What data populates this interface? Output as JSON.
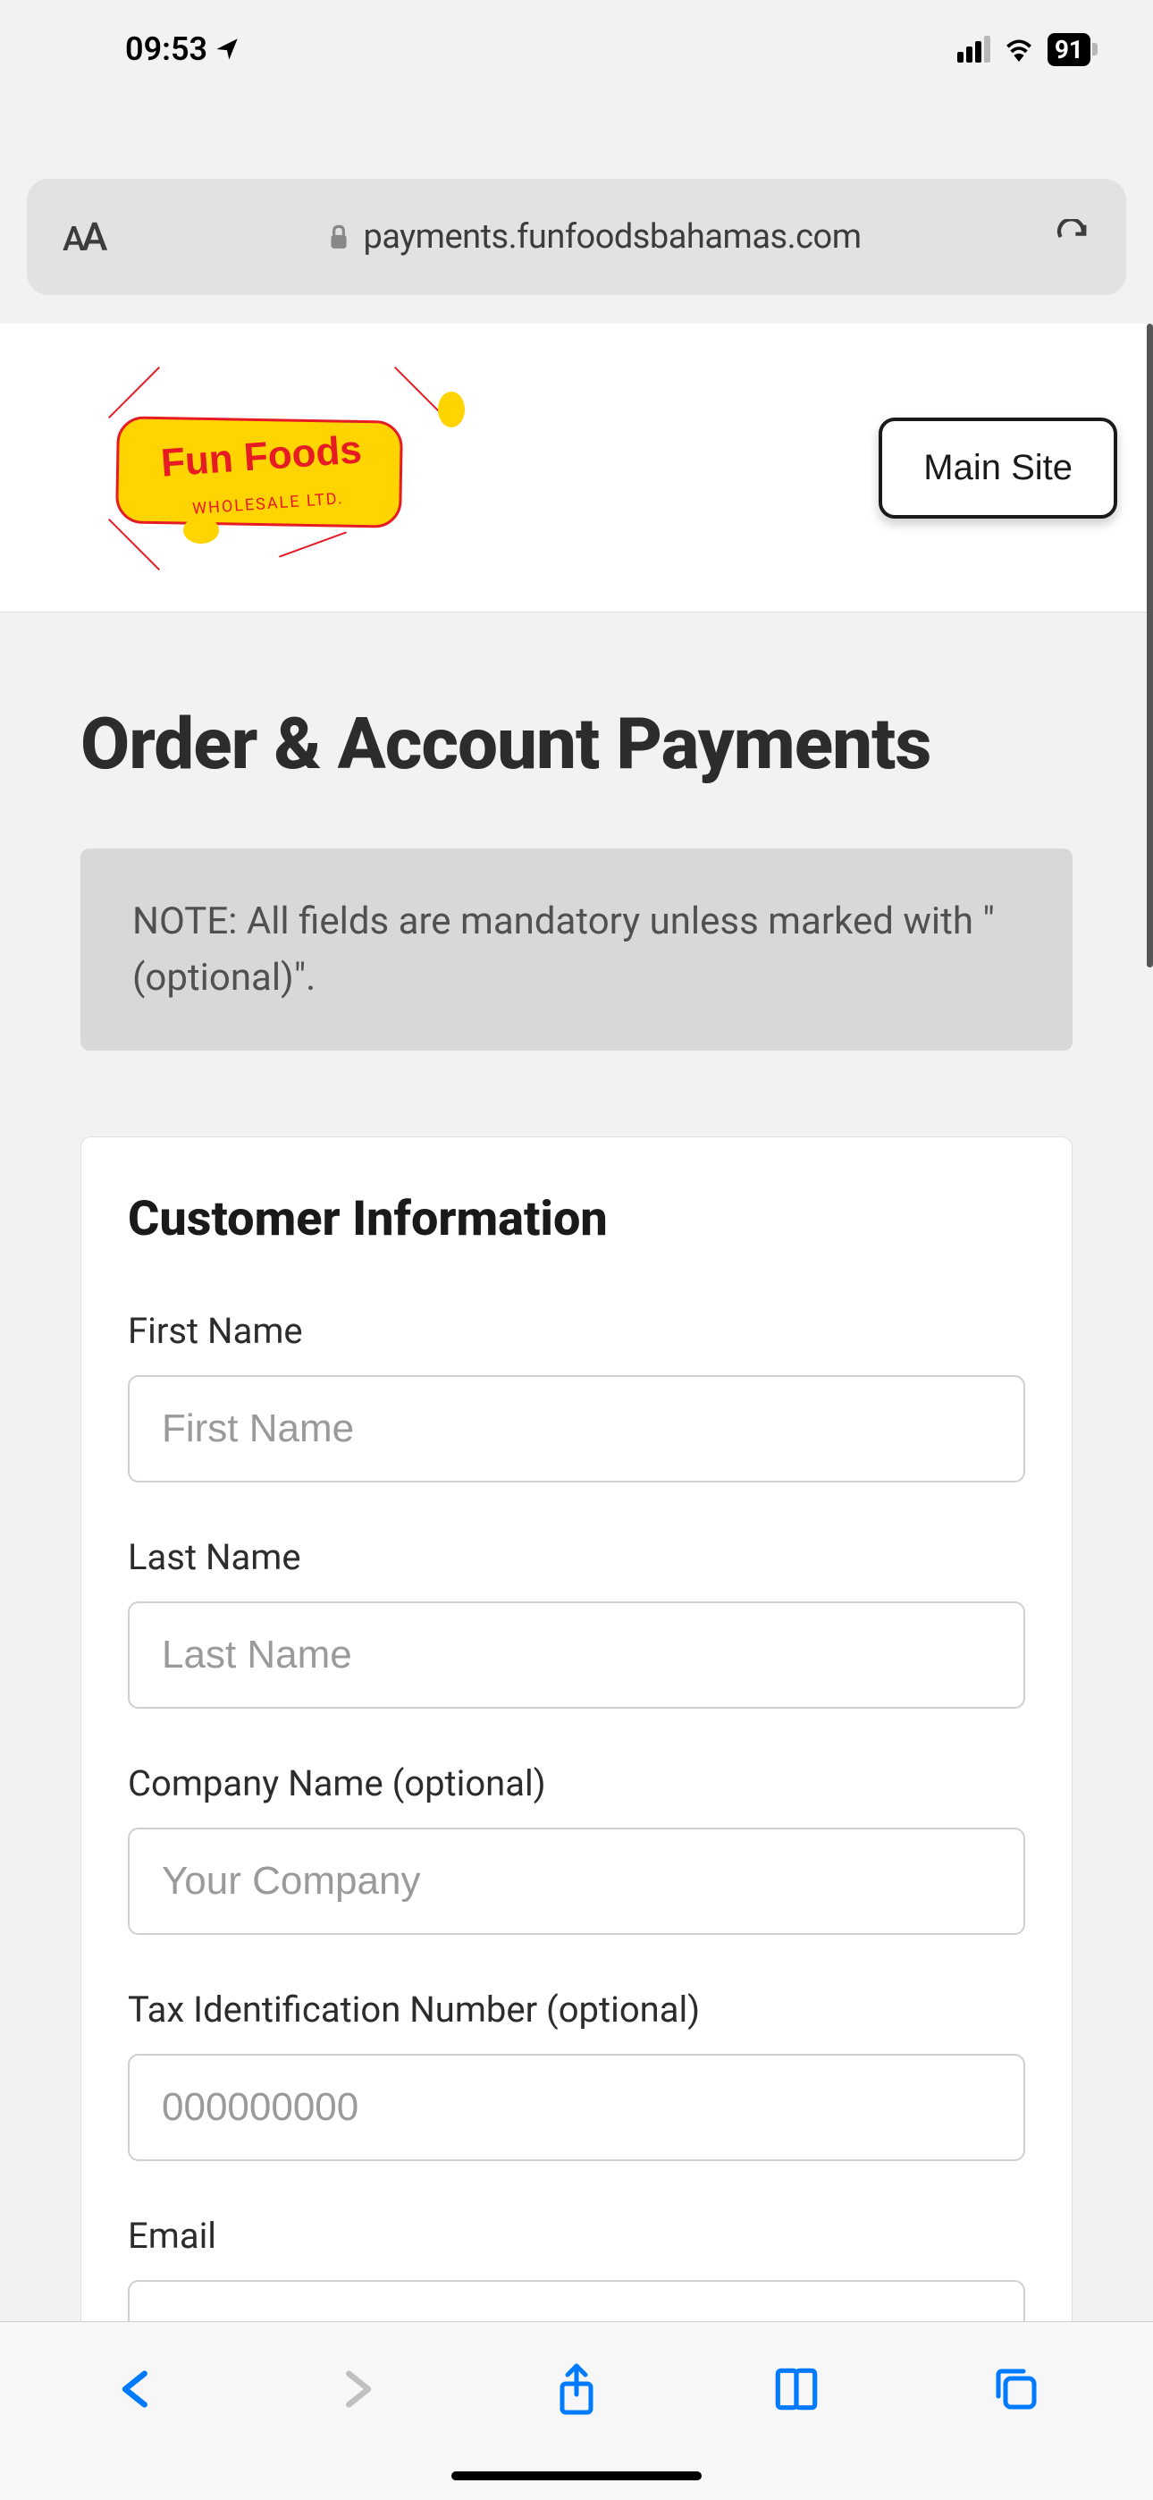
{
  "status_bar": {
    "time": "09:53",
    "battery": "91"
  },
  "address_bar": {
    "domain": "payments.funfoodsbahamas.com"
  },
  "header": {
    "logo_text": "Fun Foods",
    "logo_sub": "WHOLESALE LTD.",
    "main_site_btn": "Main Site"
  },
  "page": {
    "title": "Order & Account Payments",
    "note": "NOTE: All fields are mandatory unless marked with \"(optional)\"."
  },
  "form": {
    "section_title": "Customer Information",
    "fields": {
      "first_name": {
        "label": "First Name",
        "placeholder": "First Name"
      },
      "last_name": {
        "label": "Last Name",
        "placeholder": "Last Name"
      },
      "company": {
        "label": "Company Name (optional)",
        "placeholder": "Your Company"
      },
      "tin": {
        "label": "Tax Identification Number (optional)",
        "placeholder": "000000000"
      },
      "email": {
        "label": "Email",
        "placeholder": ""
      }
    }
  }
}
